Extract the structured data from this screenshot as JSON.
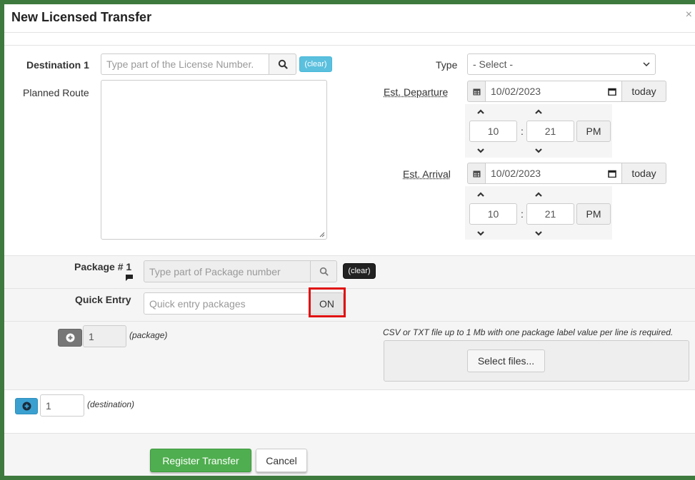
{
  "modal": {
    "title": "New Licensed Transfer",
    "close_label": "×"
  },
  "destination": {
    "label": "Destination 1",
    "placeholder": "Type part of the License Number.",
    "clear_label": "(clear)"
  },
  "route": {
    "label": "Planned Route",
    "value": ""
  },
  "type": {
    "label": "Type",
    "selected": "- Select -"
  },
  "departure": {
    "label": "Est. Departure",
    "date": "10/02/2023",
    "today_label": "today",
    "hour": "10",
    "minute": "21",
    "separator": ":",
    "ampm": "PM"
  },
  "arrival": {
    "label": "Est. Arrival",
    "date": "10/02/2023",
    "today_label": "today",
    "hour": "10",
    "minute": "21",
    "separator": ":",
    "ampm": "PM"
  },
  "package": {
    "label": "Package # 1",
    "placeholder": "Type part of Package number",
    "clear_label": "(clear)"
  },
  "quick_entry": {
    "label": "Quick Entry",
    "placeholder": "Quick entry packages",
    "toggle_label": "ON"
  },
  "package_count": {
    "value": "1",
    "suffix": "(package)"
  },
  "upload": {
    "help": "CSV or TXT file up to 1 Mb with one package label value per line is required.",
    "button_label": "Select files..."
  },
  "destination_count": {
    "value": "1",
    "suffix": "(destination)"
  },
  "footer": {
    "register_label": "Register Transfer",
    "cancel_label": "Cancel"
  },
  "colors": {
    "accent_green": "#4fae4f",
    "info_blue": "#5bc0de",
    "highlight_red": "#e01010"
  }
}
